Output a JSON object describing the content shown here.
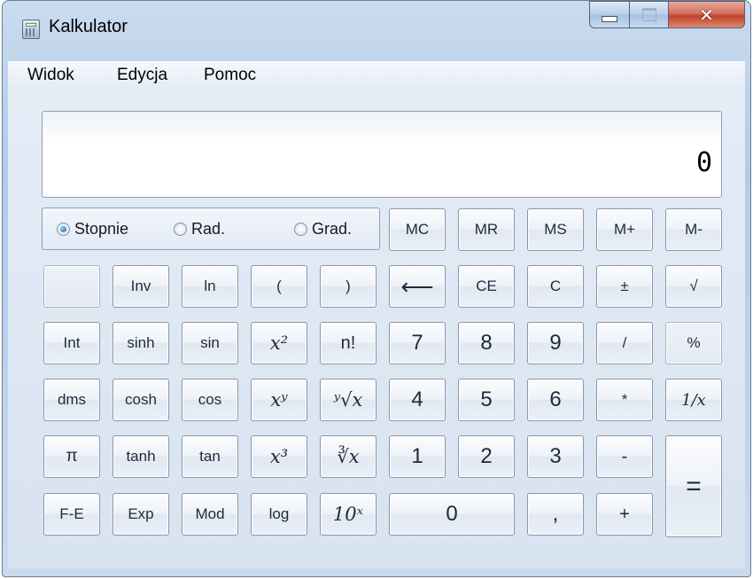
{
  "window": {
    "title": "Kalkulator",
    "icon": "calculator-icon"
  },
  "menu": {
    "items": [
      {
        "key": "widok",
        "label": "Widok"
      },
      {
        "key": "edycja",
        "label": "Edycja"
      },
      {
        "key": "pomoc",
        "label": "Pomoc"
      }
    ]
  },
  "display": {
    "value": "0"
  },
  "angle_units": {
    "selected": "Stopnie",
    "degrees": "Stopnie",
    "radians": "Rad.",
    "gradians": "Grad."
  },
  "buttons": {
    "mc": "MC",
    "mr": "MR",
    "ms": "MS",
    "mplus": "M+",
    "mminus": "M-",
    "inv": "Inv",
    "ln": "ln",
    "lparen": "(",
    "rparen": ")",
    "backspace": "⟵",
    "ce": "CE",
    "c": "C",
    "plusminus": "±",
    "sqrt": "√",
    "int": "Int",
    "sinh": "sinh",
    "sin": "sin",
    "x2": "x²",
    "fact": "n!",
    "n7": "7",
    "n8": "8",
    "n9": "9",
    "div": "/",
    "percent": "%",
    "dms": "dms",
    "cosh": "cosh",
    "cos": "cos",
    "xy": "xʸ",
    "yroot": "ʸ√x",
    "n4": "4",
    "n5": "5",
    "n6": "6",
    "mul": "*",
    "recip": "1/x",
    "pi": "π",
    "tanh": "tanh",
    "tan": "tan",
    "x3": "x³",
    "cuberoot": "∛x",
    "n1": "1",
    "n2": "2",
    "n3": "3",
    "sub": "-",
    "equals": "=",
    "fe": "F-E",
    "exp": "Exp",
    "mod": "Mod",
    "log": "log",
    "ten_x": "10ˣ",
    "n0": "0",
    "decimal": ",",
    "add": "+"
  },
  "colors": {
    "accent": "#1a5fb0",
    "close": "#c1412b",
    "frame": "#b3cbe6"
  }
}
